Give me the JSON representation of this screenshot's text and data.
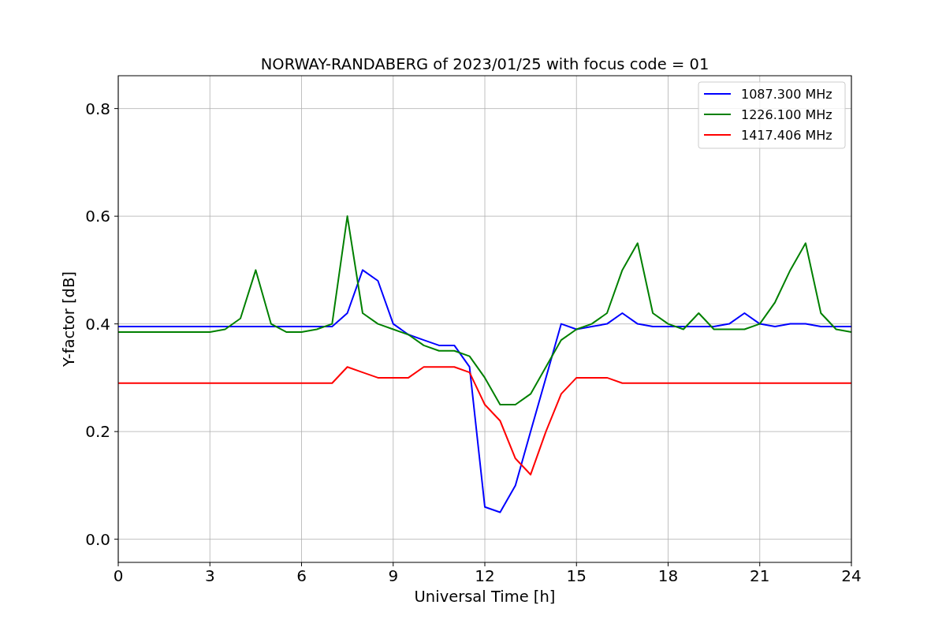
{
  "chart_data": {
    "type": "line",
    "title": "NORWAY-RANDABERG of 2023/01/25 with focus code = 01",
    "xlabel": "Universal Time [h]",
    "ylabel": "Y-factor [dB]",
    "x": [
      0,
      0.5,
      1,
      1.5,
      2,
      2.5,
      3,
      3.5,
      4,
      4.5,
      5,
      5.5,
      6,
      6.5,
      7,
      7.5,
      8,
      8.5,
      9,
      9.5,
      10,
      10.5,
      11,
      11.5,
      12,
      12.5,
      13,
      13.5,
      14,
      14.5,
      15,
      15.5,
      16,
      16.5,
      17,
      17.5,
      18,
      18.5,
      19,
      19.5,
      20,
      20.5,
      21,
      21.5,
      22,
      22.5,
      23,
      23.5,
      24
    ],
    "series": [
      {
        "name": "1087.300 MHz",
        "color": "#0000ff",
        "values": [
          0.395,
          0.395,
          0.395,
          0.395,
          0.395,
          0.395,
          0.395,
          0.395,
          0.395,
          0.395,
          0.395,
          0.395,
          0.395,
          0.395,
          0.395,
          0.42,
          0.5,
          0.48,
          0.4,
          0.38,
          0.37,
          0.36,
          0.36,
          0.32,
          0.06,
          0.05,
          0.1,
          0.2,
          0.3,
          0.4,
          0.39,
          0.395,
          0.4,
          0.42,
          0.4,
          0.395,
          0.395,
          0.395,
          0.395,
          0.395,
          0.4,
          0.42,
          0.4,
          0.395,
          0.4,
          0.4,
          0.395,
          0.395,
          0.395
        ]
      },
      {
        "name": "1226.100 MHz",
        "color": "#008000",
        "values": [
          0.385,
          0.385,
          0.385,
          0.385,
          0.385,
          0.385,
          0.385,
          0.39,
          0.41,
          0.5,
          0.4,
          0.385,
          0.385,
          0.39,
          0.4,
          0.6,
          0.42,
          0.4,
          0.39,
          0.38,
          0.36,
          0.35,
          0.35,
          0.34,
          0.3,
          0.25,
          0.25,
          0.27,
          0.32,
          0.37,
          0.39,
          0.4,
          0.42,
          0.5,
          0.55,
          0.42,
          0.4,
          0.39,
          0.42,
          0.39,
          0.39,
          0.39,
          0.4,
          0.44,
          0.5,
          0.55,
          0.42,
          0.39,
          0.385
        ]
      },
      {
        "name": "1417.406 MHz",
        "color": "#ff0000",
        "values": [
          0.29,
          0.29,
          0.29,
          0.29,
          0.29,
          0.29,
          0.29,
          0.29,
          0.29,
          0.29,
          0.29,
          0.29,
          0.29,
          0.29,
          0.29,
          0.32,
          0.31,
          0.3,
          0.3,
          0.3,
          0.32,
          0.32,
          0.32,
          0.31,
          0.25,
          0.22,
          0.15,
          0.12,
          0.2,
          0.27,
          0.3,
          0.3,
          0.3,
          0.29,
          0.29,
          0.29,
          0.29,
          0.29,
          0.29,
          0.29,
          0.29,
          0.29,
          0.29,
          0.29,
          0.29,
          0.29,
          0.29,
          0.29,
          0.29
        ]
      }
    ],
    "xlim": [
      0,
      24
    ],
    "ylim": [
      -0.043,
      0.861
    ],
    "xticks": [
      0,
      3,
      6,
      9,
      12,
      15,
      18,
      21,
      24
    ],
    "yticks": [
      {
        "value": 0,
        "label": "0.0"
      },
      {
        "value": 0.2,
        "label": "0.2"
      },
      {
        "value": 0.4,
        "label": "0.4"
      },
      {
        "value": 0.6,
        "label": "0.6"
      },
      {
        "value": 0.8,
        "label": "0.8"
      }
    ],
    "grid": true,
    "legend": true
  }
}
